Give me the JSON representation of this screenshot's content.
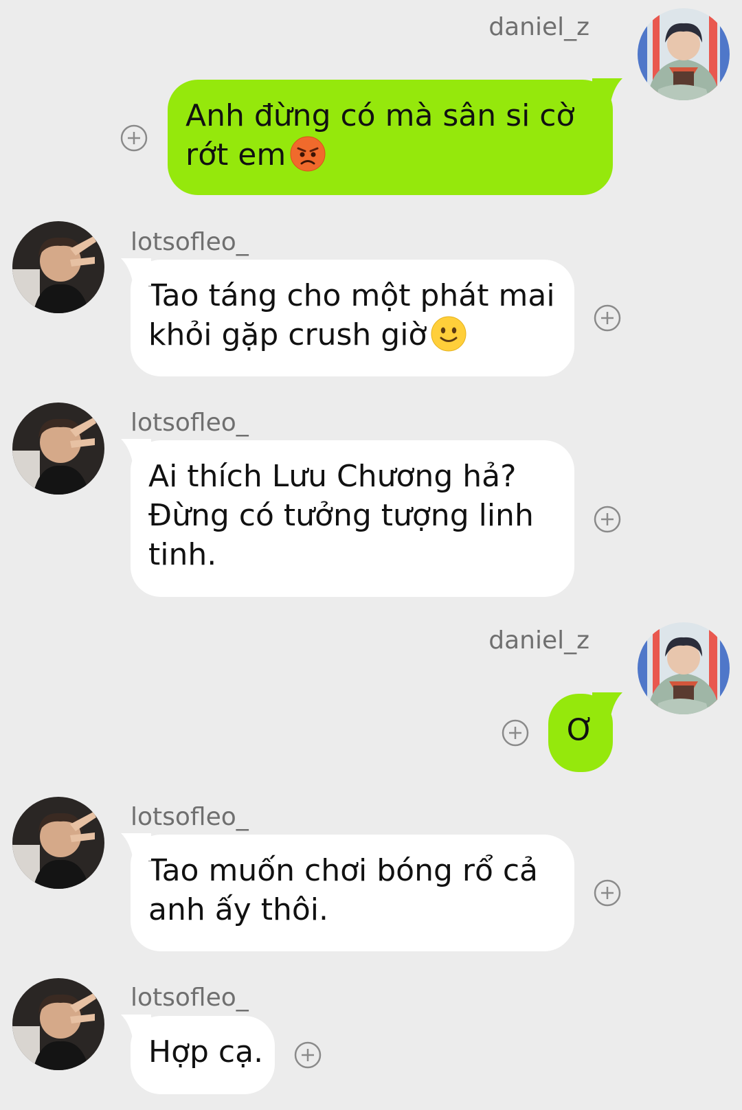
{
  "messages": [
    {
      "sender": "daniel_z",
      "side": "outgoing",
      "lines": [
        "Anh đừng có mà sân si cờ",
        "rớt em"
      ],
      "emoji": "angry-face"
    },
    {
      "sender": "lotsofleo_",
      "side": "incoming",
      "lines": [
        "Tao táng cho một phát mai",
        "khỏi gặp crush giờ"
      ],
      "emoji": "slightly-smiling-face"
    },
    {
      "sender": "lotsofleo_",
      "side": "incoming",
      "lines": [
        "Ai thích Lưu Chương hả?",
        "Đừng có tưởng tượng linh",
        "tinh."
      ]
    },
    {
      "sender": "daniel_z",
      "side": "outgoing",
      "lines": [
        "Ơ"
      ]
    },
    {
      "sender": "lotsofleo_",
      "side": "incoming",
      "lines": [
        "Tao muốn chơi bóng rổ cả",
        "anh ấy thôi."
      ]
    },
    {
      "sender": "lotsofleo_",
      "side": "incoming",
      "lines": [
        "Hợp cạ."
      ]
    }
  ],
  "colors": {
    "background": "#ececec",
    "outgoing_bubble": "#95e80c",
    "incoming_bubble": "#ffffff",
    "username": "#6f6f6f"
  }
}
